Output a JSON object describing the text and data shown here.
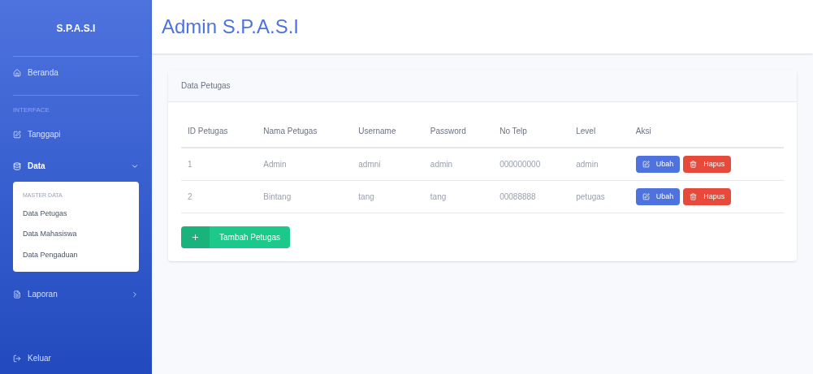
{
  "sidebar": {
    "brand": "S.P.A.S.I",
    "items": [
      {
        "kind": "link",
        "label": "Beranda"
      },
      {
        "kind": "heading",
        "label": "INTERFACE"
      },
      {
        "kind": "link",
        "label": "Tanggapi"
      },
      {
        "kind": "menu",
        "label": "Data",
        "expanded": true,
        "submenu": {
          "heading": "MASTER DATA",
          "items": [
            "Data Petugas",
            "Data Mahasiswa",
            "Data Pengaduan"
          ]
        }
      },
      {
        "kind": "menu",
        "label": "Laporan",
        "expanded": false
      },
      {
        "kind": "link",
        "label": "Keluar"
      }
    ]
  },
  "header": {
    "title": "Admin S.P.A.S.I"
  },
  "card": {
    "title": "Data Petugas",
    "table": {
      "columns": [
        "ID Petugas",
        "Nama Petugas",
        "Username",
        "Password",
        "No Telp",
        "Level",
        "Aksi"
      ],
      "rows": [
        {
          "cells": [
            "1",
            "Admin",
            "admni",
            "admin",
            "000000000",
            "admin"
          ],
          "actions": [
            "Ubah",
            "Hapus"
          ]
        },
        {
          "cells": [
            "2",
            "Bintang",
            "tang",
            "tang",
            "00088888",
            "petugas"
          ],
          "actions": [
            "Ubah",
            "Hapus"
          ]
        }
      ]
    },
    "add_button": "Tambah Petugas"
  }
}
